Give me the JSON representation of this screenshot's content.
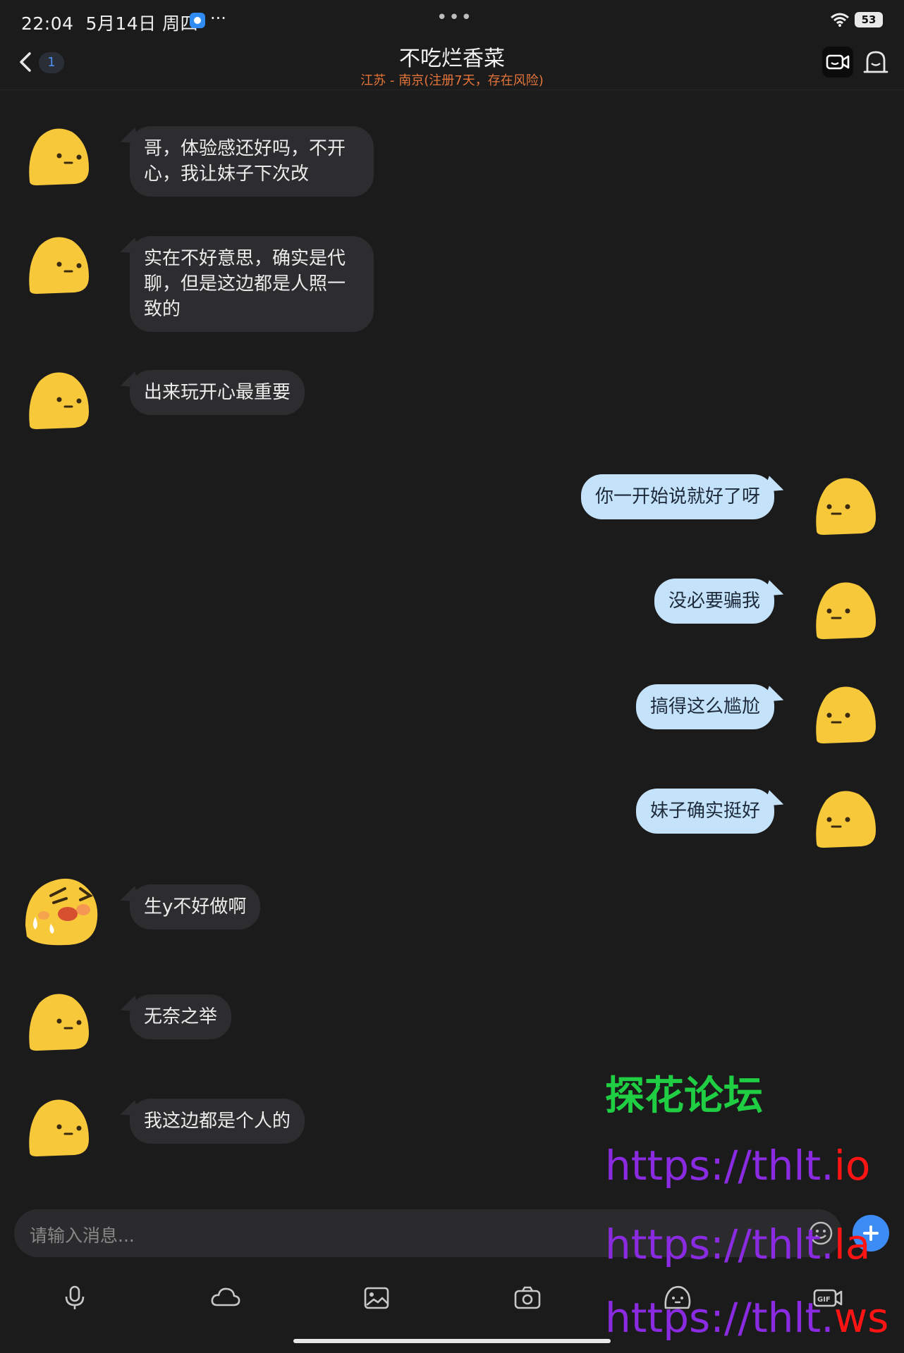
{
  "status_bar": {
    "time": "22:04",
    "date": "5月14日 周四",
    "more": "···",
    "battery": "53"
  },
  "header": {
    "unread_count": "1",
    "title": "不吃烂香菜",
    "subtitle": "江苏 - 南京(注册7天，存在风险)"
  },
  "messages": [
    {
      "side": "in",
      "avatar": "neutral-face",
      "text": "哥，体验感还好吗，不开心，我让妹子下次改"
    },
    {
      "side": "in",
      "avatar": "neutral-face",
      "text": "实在不好意思，确实是代聊，但是这边都是人照一致的"
    },
    {
      "side": "in",
      "avatar": "neutral-face",
      "text": "出来玩开心最重要"
    },
    {
      "side": "out",
      "avatar": "neutral-face",
      "text": "你一开始说就好了呀"
    },
    {
      "side": "out",
      "avatar": "neutral-face",
      "text": "没必要骗我"
    },
    {
      "side": "out",
      "avatar": "neutral-face",
      "text": "搞得这么尴尬"
    },
    {
      "side": "out",
      "avatar": "neutral-face",
      "text": "妹子确实挺好"
    },
    {
      "side": "in",
      "avatar": "laughing-tears-face",
      "text": "生y不好做啊"
    },
    {
      "side": "in",
      "avatar": "neutral-face",
      "text": "无奈之举"
    },
    {
      "side": "in",
      "avatar": "neutral-face",
      "text": "我这边都是个人的"
    }
  ],
  "watermark": {
    "title": "探花论坛",
    "urls": [
      {
        "prefix": "https://thlt.",
        "suffix": "io"
      },
      {
        "prefix": "https://thlt.",
        "suffix": "la"
      },
      {
        "prefix": "https://thlt.",
        "suffix": "ws"
      }
    ],
    "colors": {
      "title": "#1fce42",
      "prefix": "#8a2be2",
      "suffix": "#ff1414"
    }
  },
  "composer": {
    "placeholder": "请输入消息..."
  },
  "toolbar": {
    "items": [
      "microphone-icon",
      "cloud-icon",
      "image-icon",
      "camera-icon",
      "sticker-icon",
      "gif-icon"
    ]
  },
  "colors": {
    "background": "#1b1b1c",
    "incoming_bubble": "#2d2d2f",
    "outgoing_bubble": "#c5e2fb",
    "accent": "#3d8cf6",
    "warning": "#e5753a"
  }
}
